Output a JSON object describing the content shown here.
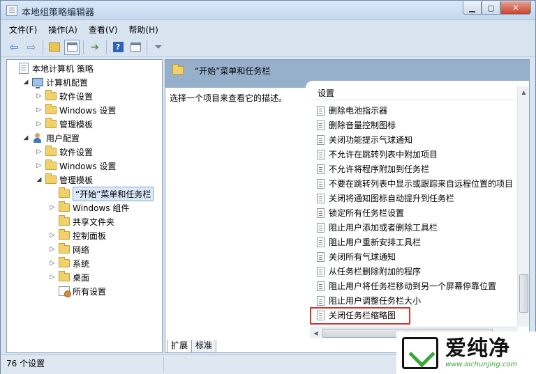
{
  "window": {
    "title": "本地组策略编辑器"
  },
  "menu": [
    "文件(F)",
    "操作(A)",
    "查看(V)",
    "帮助(H)"
  ],
  "tree": [
    {
      "label": "本地计算机 策略",
      "icon": "doc-icon",
      "twisty": "",
      "indent": 0
    },
    {
      "label": "计算机配置",
      "icon": "computer-icon",
      "twisty": "◢",
      "indent": 1
    },
    {
      "label": "软件设置",
      "icon": "folder-icon",
      "twisty": "▷",
      "indent": 2
    },
    {
      "label": "Windows 设置",
      "icon": "folder-icon",
      "twisty": "▷",
      "indent": 2
    },
    {
      "label": "管理模板",
      "icon": "folder-icon",
      "twisty": "▷",
      "indent": 2
    },
    {
      "label": "用户配置",
      "icon": "user-icon",
      "twisty": "◢",
      "indent": 1
    },
    {
      "label": "软件设置",
      "icon": "folder-icon",
      "twisty": "▷",
      "indent": 2
    },
    {
      "label": "Windows 设置",
      "icon": "folder-icon",
      "twisty": "▷",
      "indent": 2
    },
    {
      "label": "管理模板",
      "icon": "folder-icon",
      "twisty": "◢",
      "indent": 2
    },
    {
      "label": "“开始”菜单和任务栏",
      "icon": "folder-icon",
      "twisty": "",
      "indent": 3,
      "selected": true
    },
    {
      "label": "Windows 组件",
      "icon": "folder-icon",
      "twisty": "▷",
      "indent": 3
    },
    {
      "label": "共享文件夹",
      "icon": "folder-icon",
      "twisty": "",
      "indent": 3
    },
    {
      "label": "控制面板",
      "icon": "folder-icon",
      "twisty": "▷",
      "indent": 3
    },
    {
      "label": "网络",
      "icon": "folder-icon",
      "twisty": "▷",
      "indent": 3
    },
    {
      "label": "系统",
      "icon": "folder-icon",
      "twisty": "▷",
      "indent": 3
    },
    {
      "label": "桌面",
      "icon": "folder-icon",
      "twisty": "▷",
      "indent": 3
    },
    {
      "label": "所有设置",
      "icon": "settings-icon",
      "twisty": "",
      "indent": 3
    }
  ],
  "right": {
    "header": "“开始”菜单和任务栏",
    "description": "选择一个项目来查看它的描述。",
    "column_header": "设置",
    "items": [
      "删除电池指示器",
      "删除音量控制图标",
      "关闭功能提示气球通知",
      "不允许在跳转列表中附加项目",
      "不允许将程序附加到任务栏",
      "不要在跳转列表中显示或跟踪来自远程位置的项目",
      "关闭将通知图标自动提升到任务栏",
      "锁定所有任务栏设置",
      "阻止用户添加或者删除工具栏",
      "阻止用户重新安排工具栏",
      "关闭所有气球通知",
      "从任务栏删除附加的程序",
      "阻止用户将任务栏移动到另一个屏幕停靠位置",
      "阻止用户调整任务栏大小",
      "关闭任务栏缩略图"
    ],
    "highlighted_item": "关闭任务栏缩略图"
  },
  "tabs": [
    "扩展",
    "标准"
  ],
  "status": {
    "text": "76 个设置"
  },
  "watermark": {
    "text": "爱纯净",
    "url": "www.aichunjing.com"
  }
}
